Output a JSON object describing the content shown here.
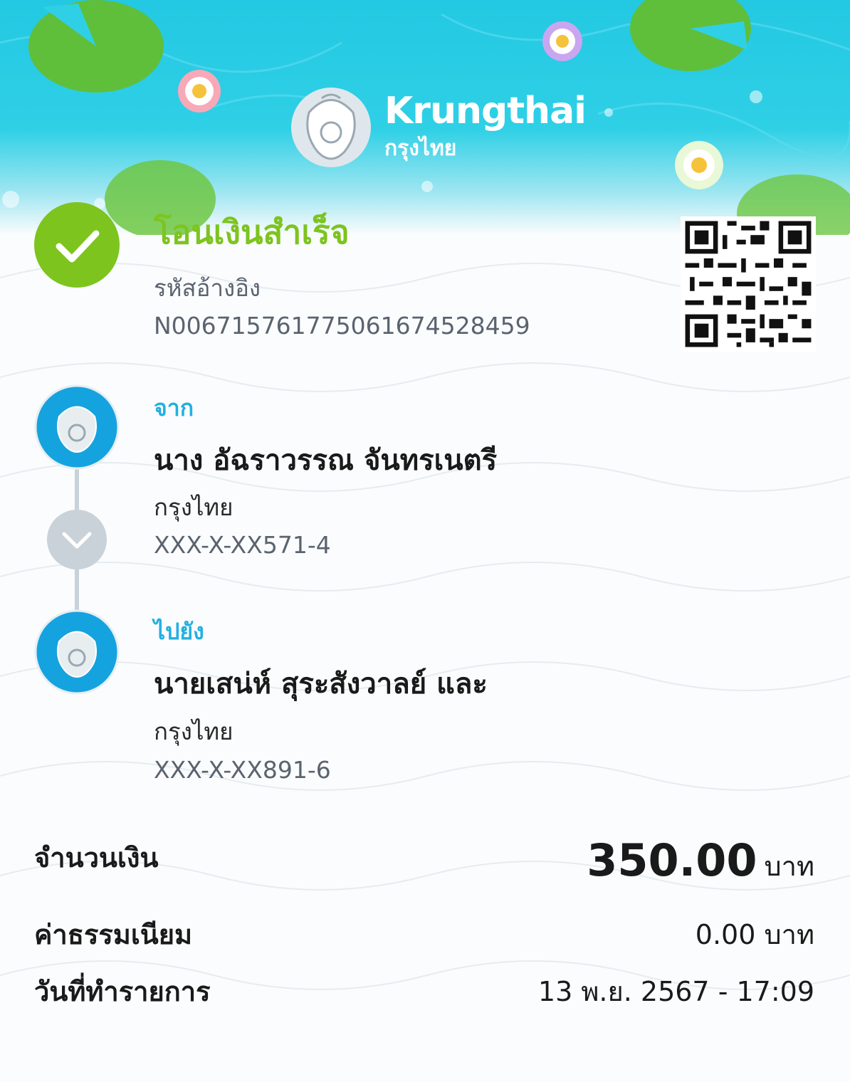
{
  "brand": {
    "name_en": "Krungthai",
    "name_th": "กรุงไทย"
  },
  "status": {
    "title": "โอนเงินสำเร็จ",
    "icon": "check-circle-icon",
    "color": "#7dc41f"
  },
  "reference": {
    "label": "รหัสอ้างอิง",
    "value": "N006715761775061674528459"
  },
  "qr": {
    "icon": "qr-code"
  },
  "sender": {
    "label": "จาก",
    "name": "นาง อัฉราวรรณ จันทรเนตรี",
    "bank": "กรุงไทย",
    "account": "XXX-X-XX571-4"
  },
  "receiver": {
    "label": "ไปยัง",
    "name": "นายเสน่ห์ สุระสังวาลย์ และ",
    "bank": "กรุงไทย",
    "account": "XXX-X-XX891-6"
  },
  "amount": {
    "label": "จำนวนเงิน",
    "value": "350.00",
    "unit": "บาท"
  },
  "fee": {
    "label": "ค่าธรรมเนียม",
    "value": "0.00 บาท"
  },
  "date": {
    "label": "วันที่ทำรายการ",
    "value": "13 พ.ย. 2567 - 17:09"
  },
  "colors": {
    "accent_blue": "#23b0e0",
    "banner": "#2fd0e6",
    "success_green": "#7dc41f"
  }
}
